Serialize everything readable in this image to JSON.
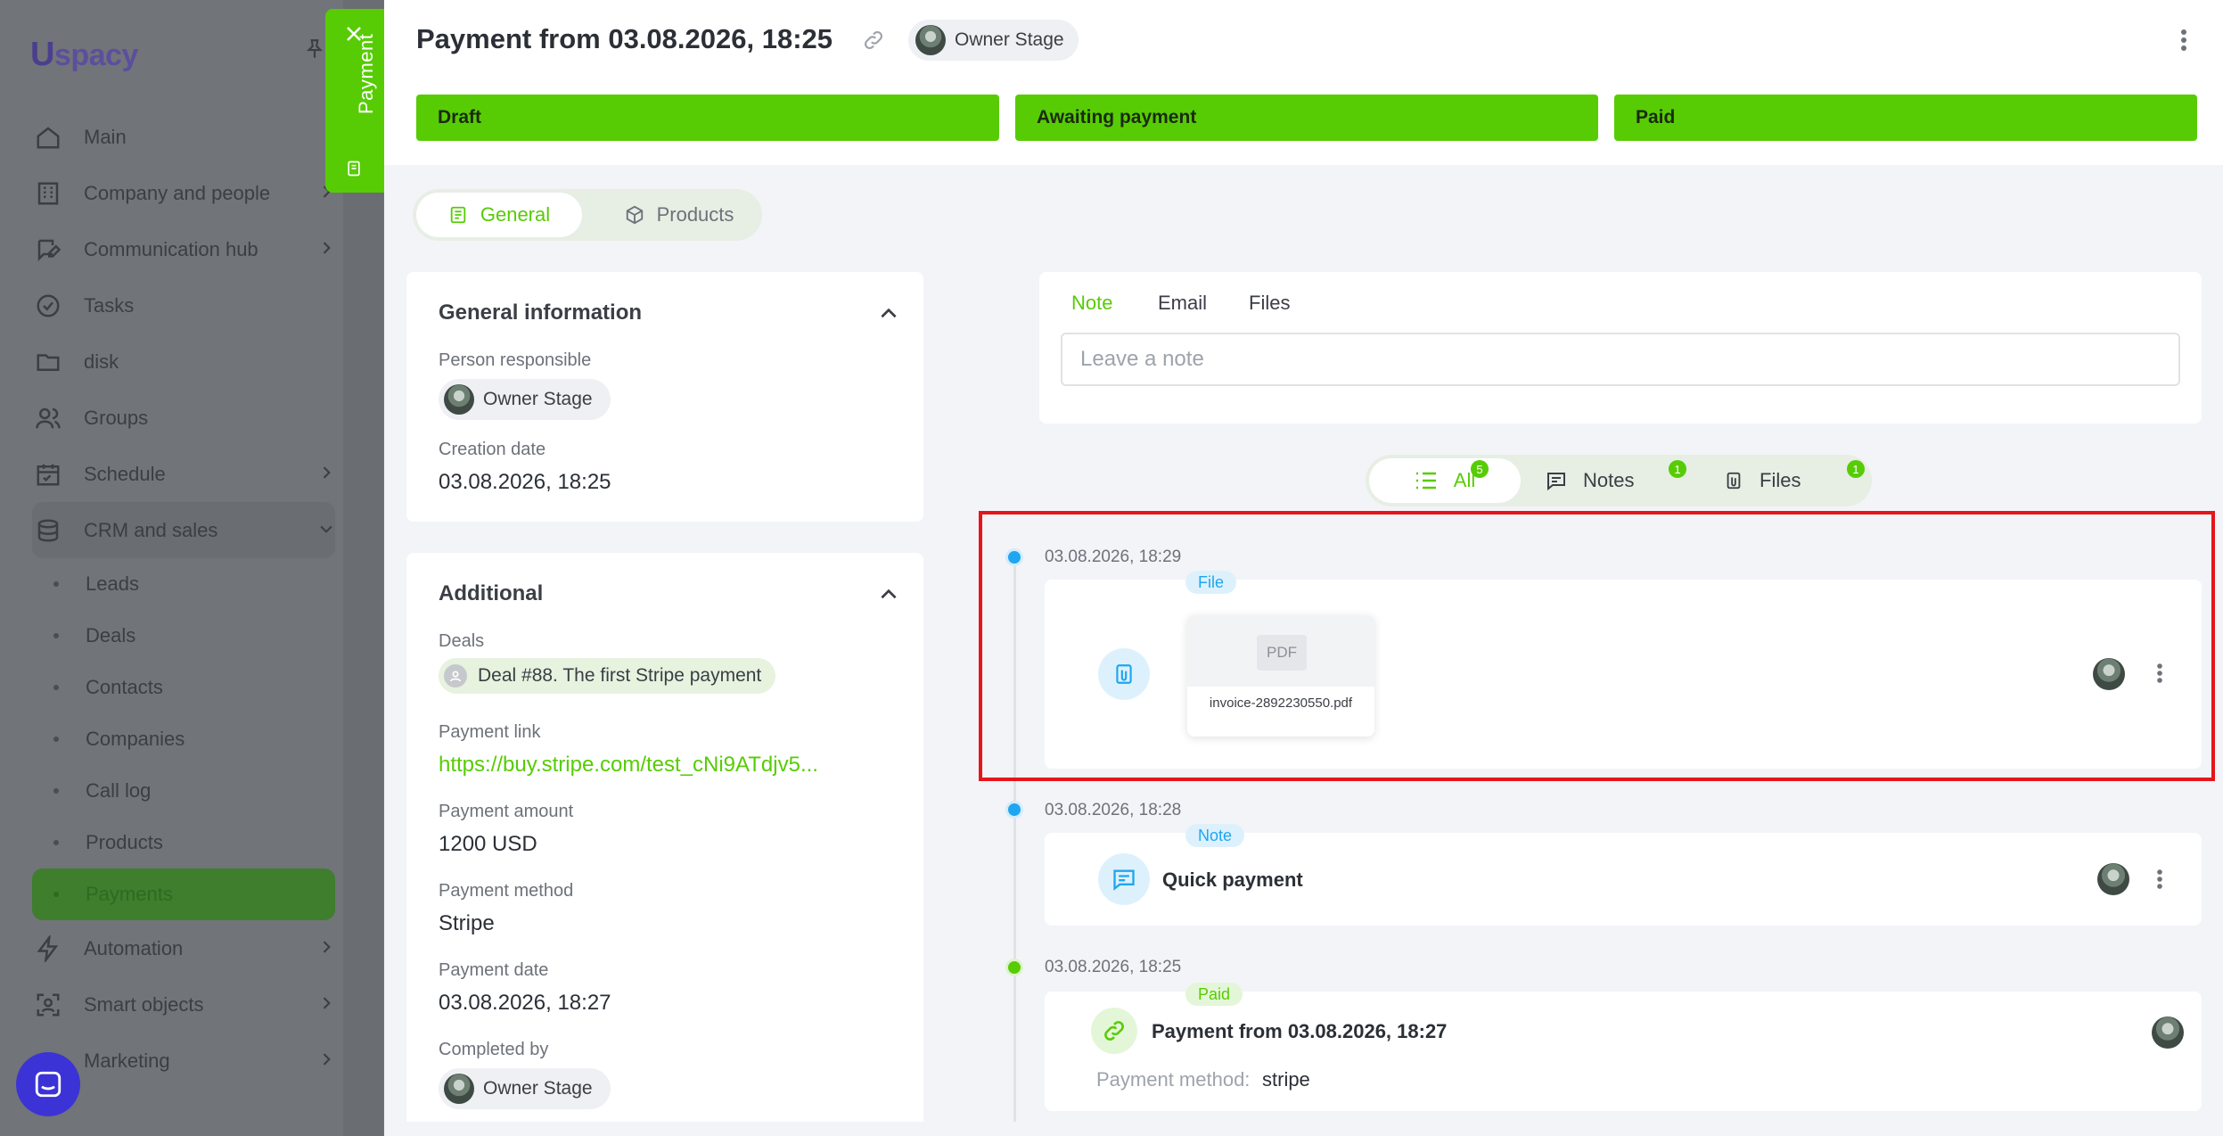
{
  "app": {
    "logo_letter": "U",
    "logo_text": "spacy"
  },
  "sidebar": {
    "items": [
      {
        "label": "Main",
        "icon": "home-icon"
      },
      {
        "label": "Company and people",
        "icon": "building-icon",
        "has_children": true
      },
      {
        "label": "Communication hub",
        "icon": "chat-edit-icon",
        "has_children": true
      },
      {
        "label": "Tasks",
        "icon": "check-circle-icon"
      },
      {
        "label": "disk",
        "icon": "folder-icon"
      },
      {
        "label": "Groups",
        "icon": "users-icon"
      },
      {
        "label": "Schedule",
        "icon": "calendar-icon",
        "has_children": true
      },
      {
        "label": "CRM and sales",
        "icon": "database-icon",
        "expanded": true
      }
    ],
    "crm_sub": [
      "Leads",
      "Deals",
      "Contacts",
      "Companies",
      "Call log",
      "Products",
      "Payments"
    ],
    "after": [
      {
        "label": "Automation",
        "icon": "bolt-icon"
      },
      {
        "label": "Smart objects",
        "icon": "scan-icon"
      },
      {
        "label": "Marketing",
        "icon": "megaphone-icon"
      }
    ]
  },
  "side_tab": {
    "label": "Payment"
  },
  "header": {
    "title": "Payment from 03.08.2026, 18:25",
    "owner": "Owner Stage",
    "stages": [
      "Draft",
      "Awaiting payment",
      "Paid"
    ]
  },
  "tabs": {
    "general": "General",
    "products": "Products"
  },
  "general_info": {
    "title": "General information",
    "person_label": "Person responsible",
    "person": "Owner Stage",
    "created_label": "Creation date",
    "created": "03.08.2026, 18:25"
  },
  "additional": {
    "title": "Additional",
    "deals_label": "Deals",
    "deal": "Deal #88. The first Stripe payment",
    "link_label": "Payment link",
    "link": "https://buy.stripe.com/test_cNi9ATdjv5...",
    "amount_label": "Payment amount",
    "amount": "1200 USD",
    "method_label": "Payment method",
    "method": "Stripe",
    "date_label": "Payment date",
    "date": "03.08.2026, 18:27",
    "completed_label": "Completed by",
    "completed": "Owner Stage"
  },
  "composer": {
    "tabs": [
      "Note",
      "Email",
      "Files"
    ],
    "placeholder": "Leave a note"
  },
  "filters": {
    "all": "All",
    "all_count": "5",
    "notes": "Notes",
    "notes_count": "1",
    "files": "Files",
    "files_count": "1"
  },
  "timeline": [
    {
      "time": "03.08.2026, 18:29",
      "badge": "File",
      "file_type": "PDF",
      "file_name": "invoice-2892230550.pdf"
    },
    {
      "time": "03.08.2026, 18:28",
      "badge": "Note",
      "text": "Quick payment"
    },
    {
      "time": "03.08.2026, 18:25",
      "badge": "Paid",
      "title": "Payment from 03.08.2026, 18:27",
      "method_label": "Payment method:",
      "method": "stripe"
    }
  ],
  "colors": {
    "accent": "#57cc04",
    "highlight": "#e5151c",
    "info": "#1fa6f0"
  }
}
